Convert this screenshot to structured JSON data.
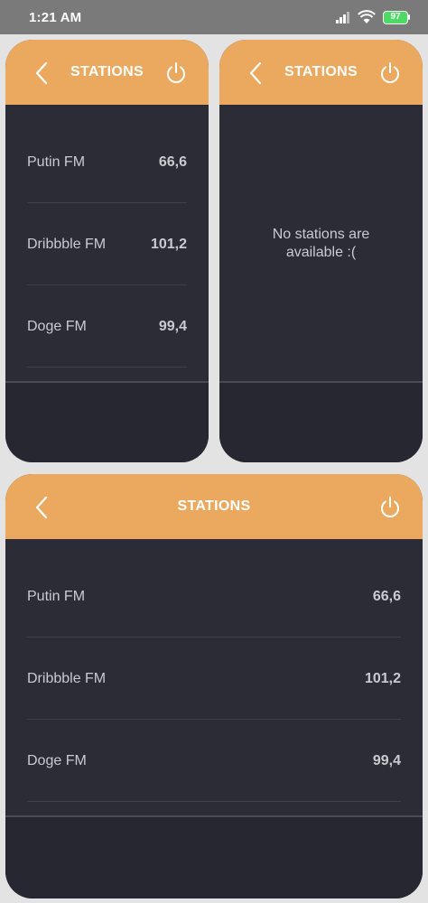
{
  "status_bar": {
    "time": "1:21 AM",
    "battery": "97",
    "icons": [
      "signal-icon",
      "wifi-icon",
      "battery-icon"
    ]
  },
  "colors": {
    "header": "#eaa95f",
    "card_bg": "#2b2c36",
    "text": "#c9cbd3"
  },
  "card_small_list": {
    "title": "STATIONS",
    "stations": [
      {
        "name": "Putin FM",
        "frequency": "66,6"
      },
      {
        "name": "Dribbble FM",
        "frequency": "101,2"
      },
      {
        "name": "Doge FM",
        "frequency": "99,4"
      }
    ]
  },
  "card_small_empty": {
    "title": "STATIONS",
    "empty_line1": "No stations are",
    "empty_line2": "available :("
  },
  "card_large_list": {
    "title": "STATIONS",
    "stations": [
      {
        "name": "Putin FM",
        "frequency": "66,6"
      },
      {
        "name": "Dribbble FM",
        "frequency": "101,2"
      },
      {
        "name": "Doge FM",
        "frequency": "99,4"
      }
    ]
  }
}
